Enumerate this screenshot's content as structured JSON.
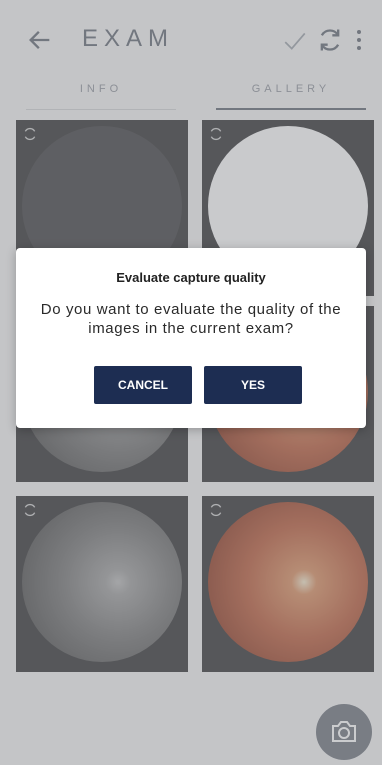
{
  "appbar": {
    "title": "EXAM",
    "icons": [
      "arrow-back-icon",
      "check-icon",
      "sync-icon",
      "more-vert-icon"
    ]
  },
  "tabs": [
    {
      "label": "INFO",
      "selected": false
    },
    {
      "label": "GALLERY",
      "selected": true
    }
  ],
  "gallery": {
    "tiles": [
      {
        "image": "dark-fundus"
      },
      {
        "image": "white-fundus"
      },
      {
        "image": "gray-fundus"
      },
      {
        "image": "color-fundus"
      },
      {
        "image": "gray-fundus"
      },
      {
        "image": "color-fundus"
      }
    ]
  },
  "dialog": {
    "title": "Evaluate capture quality",
    "message": "Do you want to evaluate the quality of the images in the current exam?",
    "cancel_label": "CANCEL",
    "confirm_label": "YES"
  },
  "fab": {
    "icon": "camera-icon"
  },
  "colors": {
    "primary_button": "#1d2d52",
    "scrim": "#8c8e92",
    "fab": "#6a6f79"
  }
}
